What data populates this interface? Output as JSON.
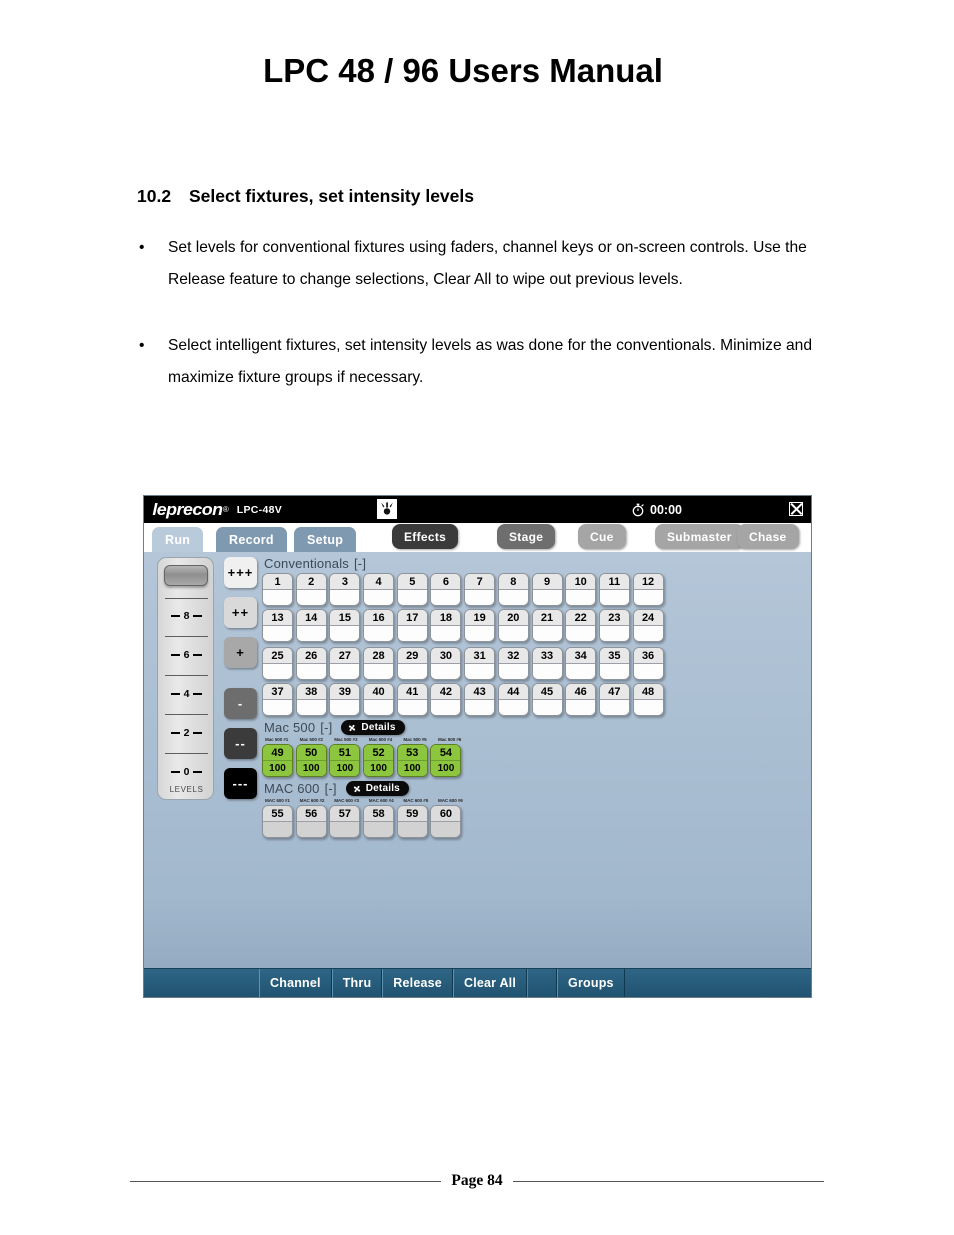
{
  "document": {
    "title": "LPC 48 / 96 Users Manual",
    "section_number": "10.2",
    "section_title": "Select fixtures, set intensity levels",
    "bullets": [
      "Set levels for conventional fixtures using faders, channel keys or on-screen controls.  Use the Release feature to change selections, Clear All to wipe out previous levels.",
      "Select intelligent fixtures, set intensity levels as was done for the conventionals.  Minimize and maximize fixture groups if necessary."
    ],
    "bullet_marker": "•",
    "footer_page": "Page 84"
  },
  "console": {
    "titlebar": {
      "brand": "leprecon",
      "brand_mark": "®",
      "model": "LPC-48V",
      "fixture_icon": "moving-light-icon",
      "timer_icon": "stopwatch-icon",
      "timer": "00:00",
      "close_icon": "close-icon"
    },
    "tabs": [
      {
        "label": "Run",
        "state": "active"
      },
      {
        "label": "Record",
        "state": "idle"
      },
      {
        "label": "Setup",
        "state": "idle"
      }
    ],
    "top_buttons": [
      {
        "label": "Effects",
        "style": "dark"
      },
      {
        "label": "Stage",
        "style": "greyon"
      },
      {
        "label": "Cue",
        "style": "greyoff"
      },
      {
        "label": "Submaster",
        "style": "greyoff"
      },
      {
        "label": "Chase",
        "style": "greyoff"
      }
    ],
    "fader": {
      "ticks": [
        "8",
        "6",
        "4",
        "2",
        "0"
      ],
      "caption": "LEVELS"
    },
    "level_buttons": [
      {
        "label": "+++",
        "bg": "#f0f0f0",
        "fg": "#000"
      },
      {
        "label": "++",
        "bg": "#d9d9d9",
        "fg": "#000"
      },
      {
        "label": "+",
        "bg": "#a8a8a8",
        "fg": "#000"
      },
      {
        "label": "-",
        "bg": "#6d6d6d",
        "fg": "#ffffff"
      },
      {
        "label": "--",
        "bg": "#3b3b3b",
        "fg": "#ffffff"
      },
      {
        "label": "---",
        "bg": "#000000",
        "fg": "#ffffff"
      }
    ],
    "groups": [
      {
        "name": "Conventionals",
        "collapse_marker": "[-]",
        "has_details": false,
        "details_label": "",
        "fixture_labels": [],
        "rows": [
          [
            {
              "num": "1",
              "value": ""
            },
            {
              "num": "2",
              "value": ""
            },
            {
              "num": "3",
              "value": ""
            },
            {
              "num": "4",
              "value": ""
            },
            {
              "num": "5",
              "value": ""
            },
            {
              "num": "6",
              "value": ""
            },
            {
              "num": "7",
              "value": ""
            },
            {
              "num": "8",
              "value": ""
            },
            {
              "num": "9",
              "value": ""
            },
            {
              "num": "10",
              "value": ""
            },
            {
              "num": "11",
              "value": ""
            },
            {
              "num": "12",
              "value": ""
            }
          ],
          [
            {
              "num": "13",
              "value": ""
            },
            {
              "num": "14",
              "value": ""
            },
            {
              "num": "15",
              "value": ""
            },
            {
              "num": "16",
              "value": ""
            },
            {
              "num": "17",
              "value": ""
            },
            {
              "num": "18",
              "value": ""
            },
            {
              "num": "19",
              "value": ""
            },
            {
              "num": "20",
              "value": ""
            },
            {
              "num": "21",
              "value": ""
            },
            {
              "num": "22",
              "value": ""
            },
            {
              "num": "23",
              "value": ""
            },
            {
              "num": "24",
              "value": ""
            }
          ],
          [
            {
              "num": "25",
              "value": ""
            },
            {
              "num": "26",
              "value": ""
            },
            {
              "num": "27",
              "value": ""
            },
            {
              "num": "28",
              "value": ""
            },
            {
              "num": "29",
              "value": ""
            },
            {
              "num": "30",
              "value": ""
            },
            {
              "num": "31",
              "value": ""
            },
            {
              "num": "32",
              "value": ""
            },
            {
              "num": "33",
              "value": ""
            },
            {
              "num": "34",
              "value": ""
            },
            {
              "num": "35",
              "value": ""
            },
            {
              "num": "36",
              "value": ""
            }
          ],
          [
            {
              "num": "37",
              "value": ""
            },
            {
              "num": "38",
              "value": ""
            },
            {
              "num": "39",
              "value": ""
            },
            {
              "num": "40",
              "value": ""
            },
            {
              "num": "41",
              "value": ""
            },
            {
              "num": "42",
              "value": ""
            },
            {
              "num": "43",
              "value": ""
            },
            {
              "num": "44",
              "value": ""
            },
            {
              "num": "45",
              "value": ""
            },
            {
              "num": "46",
              "value": ""
            },
            {
              "num": "47",
              "value": ""
            },
            {
              "num": "48",
              "value": ""
            }
          ]
        ]
      },
      {
        "name": "Mac 500",
        "collapse_marker": "[-]",
        "has_details": true,
        "details_label": "Details",
        "details_icon": "fan-icon",
        "fixture_labels": [
          "Mac 500 #1",
          "Mac 500 #2",
          "Mac 500 #3",
          "Mac 500 #4",
          "Mac 500 #5",
          "Mac 500 #6"
        ],
        "rows": [
          [
            {
              "num": "49",
              "value": "100",
              "state": "active"
            },
            {
              "num": "50",
              "value": "100",
              "state": "active"
            },
            {
              "num": "51",
              "value": "100",
              "state": "active"
            },
            {
              "num": "52",
              "value": "100",
              "state": "active"
            },
            {
              "num": "53",
              "value": "100",
              "state": "active"
            },
            {
              "num": "54",
              "value": "100",
              "state": "active"
            }
          ]
        ]
      },
      {
        "name": "MAC 600",
        "collapse_marker": "[-]",
        "has_details": true,
        "details_label": "Details",
        "details_icon": "fan-icon",
        "fixture_labels": [
          "MAC 600 #1",
          "MAC 600 #2",
          "MAC 600 #3",
          "MAC 600 #4",
          "MAC 600 #5",
          "MAC 600 #6"
        ],
        "rows": [
          [
            {
              "num": "55",
              "value": "",
              "state": "dim"
            },
            {
              "num": "56",
              "value": "",
              "state": "dim"
            },
            {
              "num": "57",
              "value": "",
              "state": "dim"
            },
            {
              "num": "58",
              "value": "",
              "state": "dim"
            },
            {
              "num": "59",
              "value": "",
              "state": "dim"
            },
            {
              "num": "60",
              "value": "",
              "state": "dim"
            }
          ]
        ]
      }
    ],
    "toolbar": [
      "Channel",
      "Thru",
      "Release",
      "Clear All",
      "",
      "Groups"
    ],
    "colors": {
      "panel_bg": "#a9bed2",
      "toolbar_bg": "#2a6080",
      "tab_active": "#b9cbda",
      "tab_idle": "#7f99b0",
      "active_channel": "#8cc63f",
      "titlebar_bg": "#000000"
    }
  }
}
